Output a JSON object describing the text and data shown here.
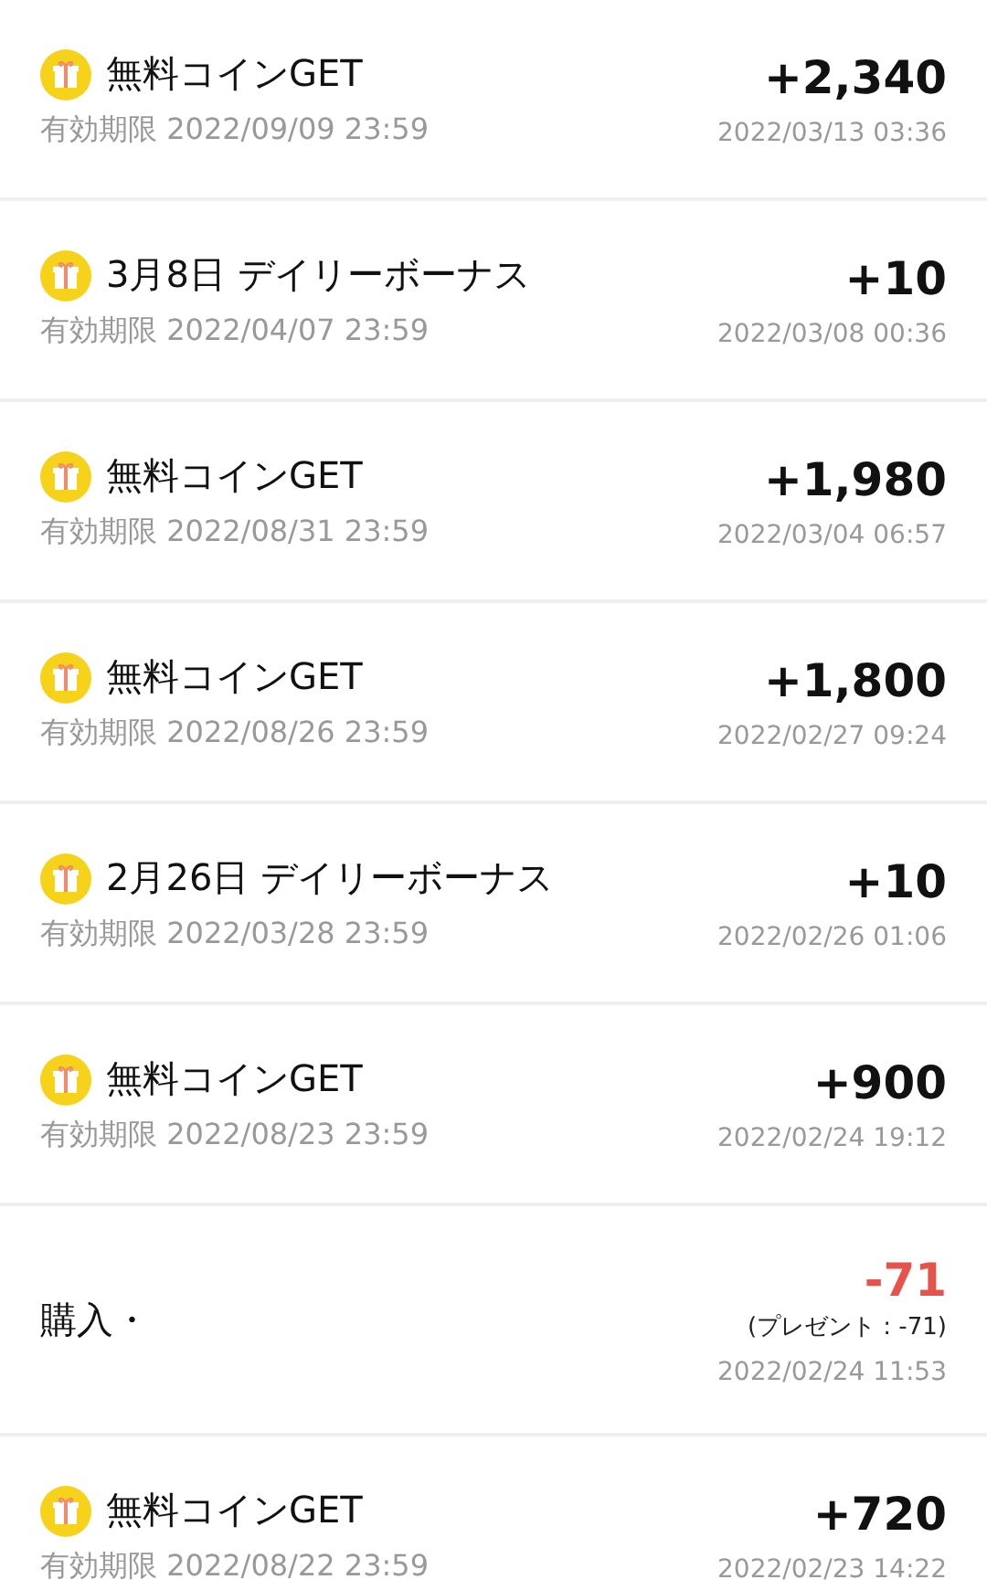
{
  "transactions": [
    {
      "kind": "gift",
      "title": "無料コインGET",
      "expiry": "有効期限 2022/09/09 23:59",
      "amount": "+2,340",
      "date": "2022/03/13 03:36"
    },
    {
      "kind": "gift",
      "title": "3月8日 デイリーボーナス",
      "expiry": "有効期限 2022/04/07 23:59",
      "amount": "+10",
      "date": "2022/03/08 00:36"
    },
    {
      "kind": "gift",
      "title": "無料コインGET",
      "expiry": "有効期限 2022/08/31 23:59",
      "amount": "+1,980",
      "date": "2022/03/04 06:57"
    },
    {
      "kind": "gift",
      "title": "無料コインGET",
      "expiry": "有効期限 2022/08/26 23:59",
      "amount": "+1,800",
      "date": "2022/02/27 09:24"
    },
    {
      "kind": "gift",
      "title": "2月26日 デイリーボーナス",
      "expiry": "有効期限 2022/03/28 23:59",
      "amount": "+10",
      "date": "2022/02/26 01:06"
    },
    {
      "kind": "gift",
      "title": "無料コインGET",
      "expiry": "有効期限 2022/08/23 23:59",
      "amount": "+900",
      "date": "2022/02/24 19:12"
    },
    {
      "kind": "purchase",
      "title": "購入・",
      "amount": "-71",
      "note": "(プレゼント : -71)",
      "date": "2022/02/24 11:53"
    },
    {
      "kind": "gift",
      "title": "無料コインGET",
      "expiry": "有効期限 2022/08/22 23:59",
      "amount": "+720",
      "date": "2022/02/23 14:22"
    }
  ]
}
